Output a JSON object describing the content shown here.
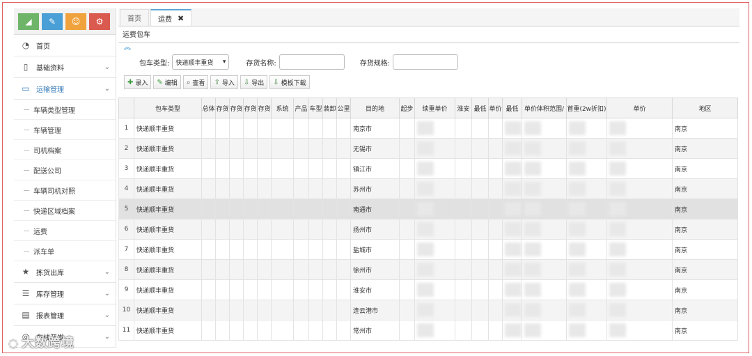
{
  "sidebar": {
    "shortcut_buttons": [
      {
        "icon": "chart-icon",
        "color": "#6fb569",
        "glyph": "◢"
      },
      {
        "icon": "pencil-icon",
        "color": "#4a9fd6",
        "glyph": "✎"
      },
      {
        "icon": "users-icon",
        "color": "#f0a33d",
        "glyph": "☺"
      },
      {
        "icon": "cogs-icon",
        "color": "#db5a4f",
        "glyph": "⚙"
      }
    ],
    "home": {
      "label": "首页",
      "icon": "dashboard-icon"
    },
    "basic": {
      "label": "基础资料",
      "icon": "file-icon"
    },
    "transport": {
      "label": "运输管理",
      "icon": "window-icon"
    },
    "transport_items": [
      "车辆类型管理",
      "车辆管理",
      "司机档案",
      "配送公司",
      "车辆司机对照",
      "快递区域档案",
      "运费",
      "派车单"
    ],
    "picking": {
      "label": "拣货出库",
      "icon": "star-icon"
    },
    "stock": {
      "label": "库存管理",
      "icon": "list-icon"
    },
    "report": {
      "label": "报表管理",
      "icon": "table-icon"
    },
    "online": {
      "label": "在线开发",
      "icon": "chat-icon"
    }
  },
  "tabs": {
    "home": "首页",
    "freight": "运费"
  },
  "breadcrumb": "运费包车",
  "filters": {
    "type_label": "包车类型:",
    "type_value": "快递顺丰重货",
    "name_label": "存货名称:",
    "name_value": "",
    "spec_label": "存货规格:",
    "spec_value": ""
  },
  "toolbar": {
    "add": "录入",
    "edit": "编辑",
    "view": "查看",
    "import": "导入",
    "export": "导出",
    "template": "模板下载"
  },
  "grid": {
    "columns": [
      "包车类型",
      "总体",
      "存货",
      "存货",
      "存货",
      "存货",
      "系统",
      "产品",
      "车型",
      "装卸",
      "公里",
      "目的地",
      "起步",
      "续重单价",
      "淮安",
      "最低",
      "单价",
      "最低",
      "单价体积范围/",
      "首重(2w折扣)",
      "单价",
      "地区"
    ],
    "rows": [
      {
        "n": "1",
        "type": "快递顺丰重货",
        "dest": "南京市",
        "region": "南京"
      },
      {
        "n": "2",
        "type": "快递顺丰重货",
        "dest": "无锡市",
        "region": "南京"
      },
      {
        "n": "3",
        "type": "快递顺丰重货",
        "dest": "镇江市",
        "region": "南京"
      },
      {
        "n": "4",
        "type": "快递顺丰重货",
        "dest": "苏州市",
        "region": "南京"
      },
      {
        "n": "5",
        "type": "快递顺丰重货",
        "dest": "南通市",
        "region": "南京"
      },
      {
        "n": "6",
        "type": "快递顺丰重货",
        "dest": "扬州市",
        "region": "南京"
      },
      {
        "n": "7",
        "type": "快递顺丰重货",
        "dest": "盐城市",
        "region": "南京"
      },
      {
        "n": "8",
        "type": "快递顺丰重货",
        "dest": "徐州市",
        "region": "南京"
      },
      {
        "n": "9",
        "type": "快递顺丰重货",
        "dest": "淮安市",
        "region": "南京"
      },
      {
        "n": "10",
        "type": "快递顺丰重货",
        "dest": "连云港市",
        "region": "南京"
      },
      {
        "n": "11",
        "type": "快递顺丰重货",
        "dest": "常州市",
        "region": "南京"
      }
    ]
  },
  "watermark": "大数跨境"
}
